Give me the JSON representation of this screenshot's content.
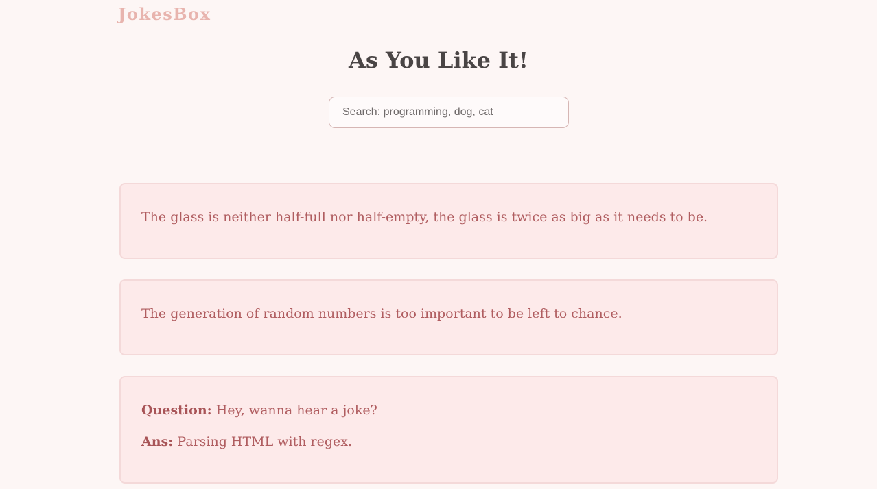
{
  "header": {
    "logo": "JokesBox"
  },
  "main": {
    "title": "As You Like It!",
    "search": {
      "placeholder": "Search: programming, dog, cat",
      "value": ""
    },
    "jokes": [
      {
        "type": "single",
        "text": "The glass is neither half-full nor half-empty, the glass is twice as big as it needs to be."
      },
      {
        "type": "single",
        "text": "The generation of random numbers is too important to be left to chance."
      },
      {
        "type": "twopart",
        "question_label": "Question:",
        "question": "Hey, wanna hear a joke?",
        "answer_label": "Ans:",
        "answer": "Parsing HTML with regex."
      }
    ]
  },
  "colors": {
    "background": "#fdf6f5",
    "logo": "#e8b4ae",
    "title": "#4a4545",
    "card_background": "#fdeaea",
    "card_border": "#f4d9d9",
    "joke_text": "#b05d60"
  }
}
